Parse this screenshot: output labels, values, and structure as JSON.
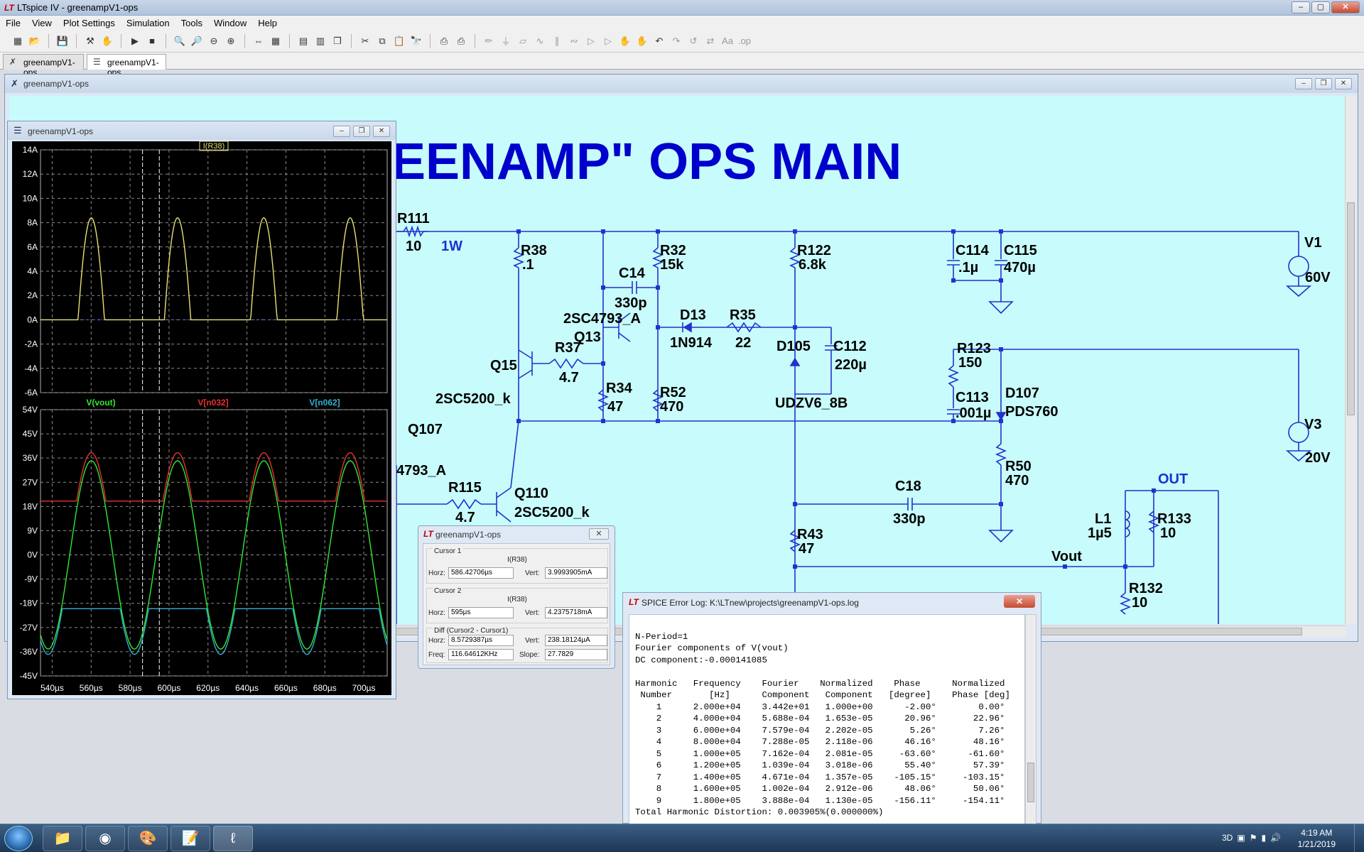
{
  "app": {
    "window_title": "LTspice IV - greenampV1-ops"
  },
  "menu": [
    "File",
    "View",
    "Plot Settings",
    "Simulation",
    "Tools",
    "Window",
    "Help"
  ],
  "tabs": [
    {
      "label": "greenampV1-ops"
    },
    {
      "label": "greenampV1-ops"
    }
  ],
  "schematic_window": {
    "title": "greenampV1-ops",
    "heading": "EENAMP\" OPS MAIN",
    "components": {
      "r111": "R111",
      "r111_val": "10",
      "r111_w": "1W",
      "r38": "R38",
      "r38_val": ".1",
      "r32": "R32",
      "r32_val": "15k",
      "c14": "C14",
      "c14_val": "330p",
      "q13_model": "2SC4793_A",
      "q13": "Q13",
      "d13": "D13",
      "d13_val": "1N914",
      "r35": "R35",
      "r35_val": "22",
      "r122": "R122",
      "r122_val": "6.8k",
      "c114": "C114",
      "c114_val": ".1µ",
      "c115": "C115",
      "c115_val": "470µ",
      "v1": "V1",
      "v1_val": "60V",
      "q15": "Q15",
      "q15_model": "2SC5200_k",
      "r37": "R37",
      "r37_val": "4.7",
      "d105": "D105",
      "d105_model": "UDZV6_8B",
      "c112": "C112",
      "c112_val": "220µ",
      "r123": "R123",
      "r123_val": "150",
      "c113": "C113",
      "c113_val": ".001µ",
      "d107": "D107",
      "d107_model": "PDS760",
      "v3": "V3",
      "v3_val": "20V",
      "r34": "R34",
      "r34_val": "47",
      "r52": "R52",
      "r52_val": "470",
      "q107": "Q107",
      "q107_model": "4793_A",
      "r115": "R115",
      "r115_val": "4.7",
      "q110": "Q110",
      "q110_model": "2SC5200_k",
      "c18": "C18",
      "c18_val": "330p",
      "r50": "R50",
      "r50_val": "470",
      "out": "OUT",
      "l1": "L1",
      "l1_val": "1µ5",
      "r133": "R133",
      "r133_val": "10",
      "r43": "R43",
      "r43_val": "47",
      "vout": "Vout",
      "r132": "R132",
      "r132_val": "10"
    }
  },
  "waveform_window": {
    "title": "greenampV1-ops"
  },
  "chart_data": [
    {
      "type": "line",
      "series": [
        {
          "name": "I(R38)",
          "color": "#e8e070"
        }
      ],
      "ylim": [
        -6,
        14
      ],
      "y_ticks": [
        "14A",
        "12A",
        "10A",
        "8A",
        "6A",
        "4A",
        "2A",
        "0A",
        "-2A",
        "-4A",
        "-6A"
      ],
      "description": "half-wave rectified sine current, peaks ~8.4A, flat 0A otherwise",
      "peaks_x": [
        560,
        597,
        635,
        672,
        708
      ],
      "peak_value": 8.4
    },
    {
      "type": "line",
      "series": [
        {
          "name": "V(vout)",
          "color": "#33e833",
          "amplitude": 35,
          "offset": 0
        },
        {
          "name": "V[n032]",
          "color": "#e83030",
          "min": 20,
          "max": 38
        },
        {
          "name": "V[n062]",
          "color": "#30b0d0",
          "min": -37,
          "max": -20
        }
      ],
      "ylim": [
        -45,
        54
      ],
      "y_ticks": [
        "54V",
        "45V",
        "36V",
        "27V",
        "18V",
        "9V",
        "0V",
        "-9V",
        "-18V",
        "-27V",
        "-36V",
        "-45V"
      ],
      "x_ticks": [
        "540µs",
        "560µs",
        "580µs",
        "600µs",
        "620µs",
        "640µs",
        "660µs",
        "680µs",
        "700µs"
      ],
      "xlim": [
        534,
        712
      ],
      "frequency_hz": 20000
    }
  ],
  "cursor_dialog": {
    "title": "greenampV1-ops",
    "cursor1_label": "Cursor 1",
    "cursor1_signal": "I(R38)",
    "cursor1_horz": "586.42706µs",
    "cursor1_vert": "3.9993905mA",
    "cursor2_label": "Cursor 2",
    "cursor2_signal": "I(R38)",
    "cursor2_horz": "595µs",
    "cursor2_vert": "4.2375718mA",
    "diff_label": "Diff (Cursor2 - Cursor1)",
    "diff_horz": "8.5729387µs",
    "diff_vert": "238.18124µA",
    "freq": "116.64612KHz",
    "slope": "27.7829",
    "horz_label": "Horz:",
    "vert_label": "Vert:",
    "freq_label": "Freq:",
    "slope_label": "Slope:"
  },
  "error_log": {
    "title": "SPICE Error Log: K:\\LTnew\\projects\\greenampV1-ops.log",
    "lines": [
      "",
      "N-Period=1",
      "Fourier components of V(vout)",
      "DC component:-0.000141085",
      "",
      "Harmonic   Frequency    Fourier    Normalized    Phase      Normalized",
      " Number       [Hz]      Component   Component   [degree]    Phase [deg]",
      "    1      2.000e+04    3.442e+01   1.000e+00      -2.00°        0.00°",
      "    2      4.000e+04    5.688e-04   1.653e-05      20.96°       22.96°",
      "    3      6.000e+04    7.579e-04   2.202e-05       5.26°        7.26°",
      "    4      8.000e+04    7.288e-05   2.118e-06      46.16°       48.16°",
      "    5      1.000e+05    7.162e-04   2.081e-05     -63.60°      -61.60°",
      "    6      1.200e+05    1.039e-04   3.018e-06      55.40°       57.39°",
      "    7      1.400e+05    4.671e-04   1.357e-05    -105.15°     -103.15°",
      "    8      1.600e+05    1.002e-04   2.912e-06      48.06°       50.06°",
      "    9      1.800e+05    3.888e-04   1.130e-05    -156.11°     -154.11°",
      "Total Harmonic Distortion: 0.003905%(0.000000%)"
    ]
  },
  "taskbar": {
    "clock_time": "4:19 AM",
    "clock_date": "1/21/2019"
  }
}
